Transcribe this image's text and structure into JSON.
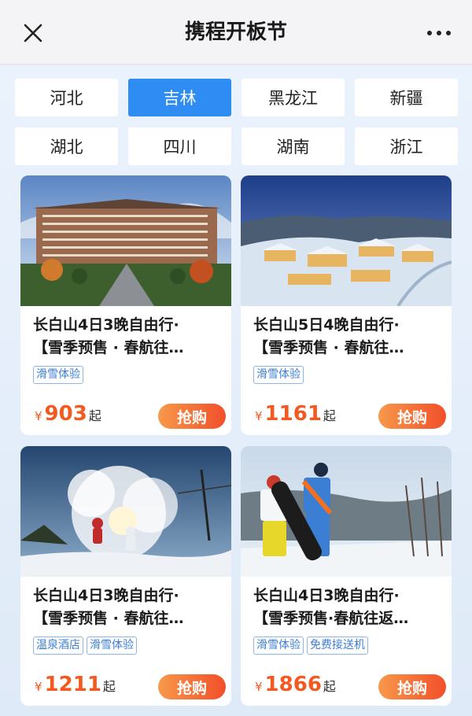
{
  "header": {
    "title": "携程开板节"
  },
  "regions": [
    {
      "label": "河北",
      "active": false
    },
    {
      "label": "吉林",
      "active": true
    },
    {
      "label": "黑龙江",
      "active": false
    },
    {
      "label": "新疆",
      "active": false
    },
    {
      "label": "湖北",
      "active": false
    },
    {
      "label": "四川",
      "active": false
    },
    {
      "label": "湖南",
      "active": false
    },
    {
      "label": "浙江",
      "active": false
    }
  ],
  "products": [
    {
      "title": "长白山4日3晚自由行·",
      "subtitle": "【雪季预售 · 春航往…",
      "tags": [
        "滑雪体验"
      ],
      "currency": "¥",
      "price": "903",
      "suffix": "起",
      "button": "抢购",
      "image": "hotel-resort-photo"
    },
    {
      "title": "长白山5日4晚自由行·",
      "subtitle": "【雪季预售 · 春航往…",
      "tags": [
        "滑雪体验"
      ],
      "currency": "¥",
      "price": "1161",
      "suffix": "起",
      "button": "抢购",
      "image": "snow-village-night-photo"
    },
    {
      "title": "长白山4日3晚自由行·",
      "subtitle": "【雪季预售 · 春航往…",
      "tags": [
        "温泉酒店",
        "滑雪体验"
      ],
      "currency": "¥",
      "price": "1211",
      "suffix": "起",
      "button": "抢购",
      "image": "splash-water-freeze-photo"
    },
    {
      "title": "长白山4日3晚自由行·",
      "subtitle": "【雪季预售·春航往返…",
      "tags": [
        "滑雪体验",
        "免费接送机"
      ],
      "currency": "¥",
      "price": "1866",
      "suffix": "起",
      "button": "抢购",
      "image": "snowboarders-photo"
    }
  ],
  "colors": {
    "accent": "#2f8cf2",
    "price": "#f25a22",
    "tag": "#3b7fd6"
  }
}
